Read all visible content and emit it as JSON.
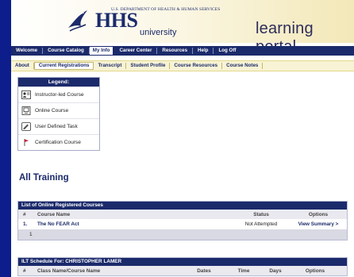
{
  "header": {
    "department": "U.S. DEPARTMENT OF HEALTH & HUMAN SERVICES",
    "brand": "HHS",
    "brand_sub": "university",
    "portal_title": "learning portal"
  },
  "nav_primary": {
    "items": [
      {
        "label": "Welcome"
      },
      {
        "label": "Course Catalog"
      },
      {
        "label": "My Info"
      },
      {
        "label": "Career Center"
      },
      {
        "label": "Resources"
      },
      {
        "label": "Help"
      },
      {
        "label": "Log Off"
      }
    ]
  },
  "nav_secondary": {
    "items": [
      {
        "label": "About"
      },
      {
        "label": "Current Registrations"
      },
      {
        "label": "Transcript"
      },
      {
        "label": "Student Profile"
      },
      {
        "label": "Course Resources"
      },
      {
        "label": "Course Notes"
      }
    ]
  },
  "legend": {
    "title": "Legend:",
    "items": [
      {
        "label": "Instructor-led Course",
        "icon": "instructor-led-icon"
      },
      {
        "label": "Online Course",
        "icon": "online-course-icon"
      },
      {
        "label": "User Defined Task",
        "icon": "user-task-icon"
      },
      {
        "label": "Certification Course",
        "icon": "certification-flag-icon"
      }
    ]
  },
  "main": {
    "title": "All Training"
  },
  "online_courses": {
    "title": "List of Online Registered Courses",
    "columns": {
      "num": "#",
      "name": "Course Name",
      "status": "Status",
      "options": "Options"
    },
    "rows": [
      {
        "num": "1.",
        "name": "The No FEAR Act",
        "status": "Not Attempted",
        "action": "View Summary >"
      }
    ],
    "pager": "1"
  },
  "ilt_schedule": {
    "title": "ILT Schedule For: CHRISTOPHER LAMER",
    "columns": {
      "num": "#",
      "name": "Class Name/Course Name",
      "dates": "Dates",
      "time": "Time",
      "days": "Days",
      "options": "Options"
    }
  },
  "colors": {
    "navy": "#1b2a6b",
    "page_bg": "#0d1d8c",
    "tab_bar": "#f7f3d4"
  }
}
